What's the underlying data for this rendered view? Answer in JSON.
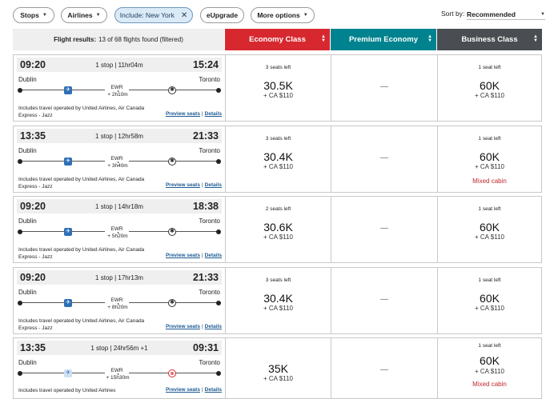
{
  "filters": {
    "stops_label": "Stops",
    "airlines_label": "Airlines",
    "include_label": "Include: New York",
    "eupgrade_label": "eUpgrade",
    "more_label": "More options",
    "sort_label": "Sort by:",
    "sort_value": "Recommended"
  },
  "header": {
    "results_bold": "Flight results:",
    "results_text": "13 of 68 flights found (filtered)",
    "economy": "Economy Class",
    "premium": "Premium Economy",
    "business": "Business Class"
  },
  "common": {
    "preview_seats": "Preview seats",
    "details": "Details",
    "link_sep": "|",
    "no_fare": "—"
  },
  "flights": [
    {
      "dep": "09:20",
      "arr": "15:24",
      "duration": "1 stop | 11hr04m",
      "from": "Dublin",
      "to": "Toronto",
      "stop_code": "EWR",
      "layover": "+ 2h10m",
      "operated": "Includes travel operated by United Airlines, Air Canada Express - Jazz",
      "eco_seats": "3 seats left",
      "eco_price": "30.5K",
      "eco_tax": "+ CA $110",
      "bus_seats": "1 seat left",
      "bus_price": "60K",
      "bus_tax": "+ CA $110",
      "bus_note": ""
    },
    {
      "dep": "13:35",
      "arr": "21:33",
      "duration": "1 stop | 12hr58m",
      "from": "Dublin",
      "to": "Toronto",
      "stop_code": "EWR",
      "layover": "+ 3h40m",
      "operated": "Includes travel operated by United Airlines, Air Canada Express - Jazz",
      "eco_seats": "3 seats left",
      "eco_price": "30.4K",
      "eco_tax": "+ CA $110",
      "bus_seats": "1 seat left",
      "bus_price": "60K",
      "bus_tax": "+ CA $110",
      "bus_note": "Mixed cabin"
    },
    {
      "dep": "09:20",
      "arr": "18:38",
      "duration": "1 stop | 14hr18m",
      "from": "Dublin",
      "to": "Toronto",
      "stop_code": "EWR",
      "layover": "+ 5h20m",
      "operated": "Includes travel operated by United Airlines, Air Canada Express - Jazz",
      "eco_seats": "2 seats left",
      "eco_price": "30.6K",
      "eco_tax": "+ CA $110",
      "bus_seats": "1 seat left",
      "bus_price": "60K",
      "bus_tax": "+ CA $110",
      "bus_note": ""
    },
    {
      "dep": "09:20",
      "arr": "21:33",
      "duration": "1 stop | 17hr13m",
      "from": "Dublin",
      "to": "Toronto",
      "stop_code": "EWR",
      "layover": "+ 8h20m",
      "operated": "Includes travel operated by United Airlines, Air Canada Express - Jazz",
      "eco_seats": "3 seats left",
      "eco_price": "30.4K",
      "eco_tax": "+ CA $110",
      "bus_seats": "1 seat left",
      "bus_price": "60K",
      "bus_tax": "+ CA $110",
      "bus_note": ""
    },
    {
      "dep": "13:35",
      "arr": "09:31",
      "duration": "1 stop | 24hr56m +1",
      "from": "Dublin",
      "to": "Toronto",
      "stop_code": "EWR",
      "layover": "+ 15h30m",
      "operated": "Includes travel operated by United Airlines",
      "eco_seats": "",
      "eco_price": "35K",
      "eco_tax": "+ CA $110",
      "bus_seats": "1 seat left",
      "bus_price": "60K",
      "bus_tax": "+ CA $110",
      "bus_note": "Mixed cabin"
    }
  ],
  "colors": {
    "economy": "#d7282f",
    "premium": "#00838f",
    "business": "#4a4d51",
    "link": "#1d5a94"
  }
}
